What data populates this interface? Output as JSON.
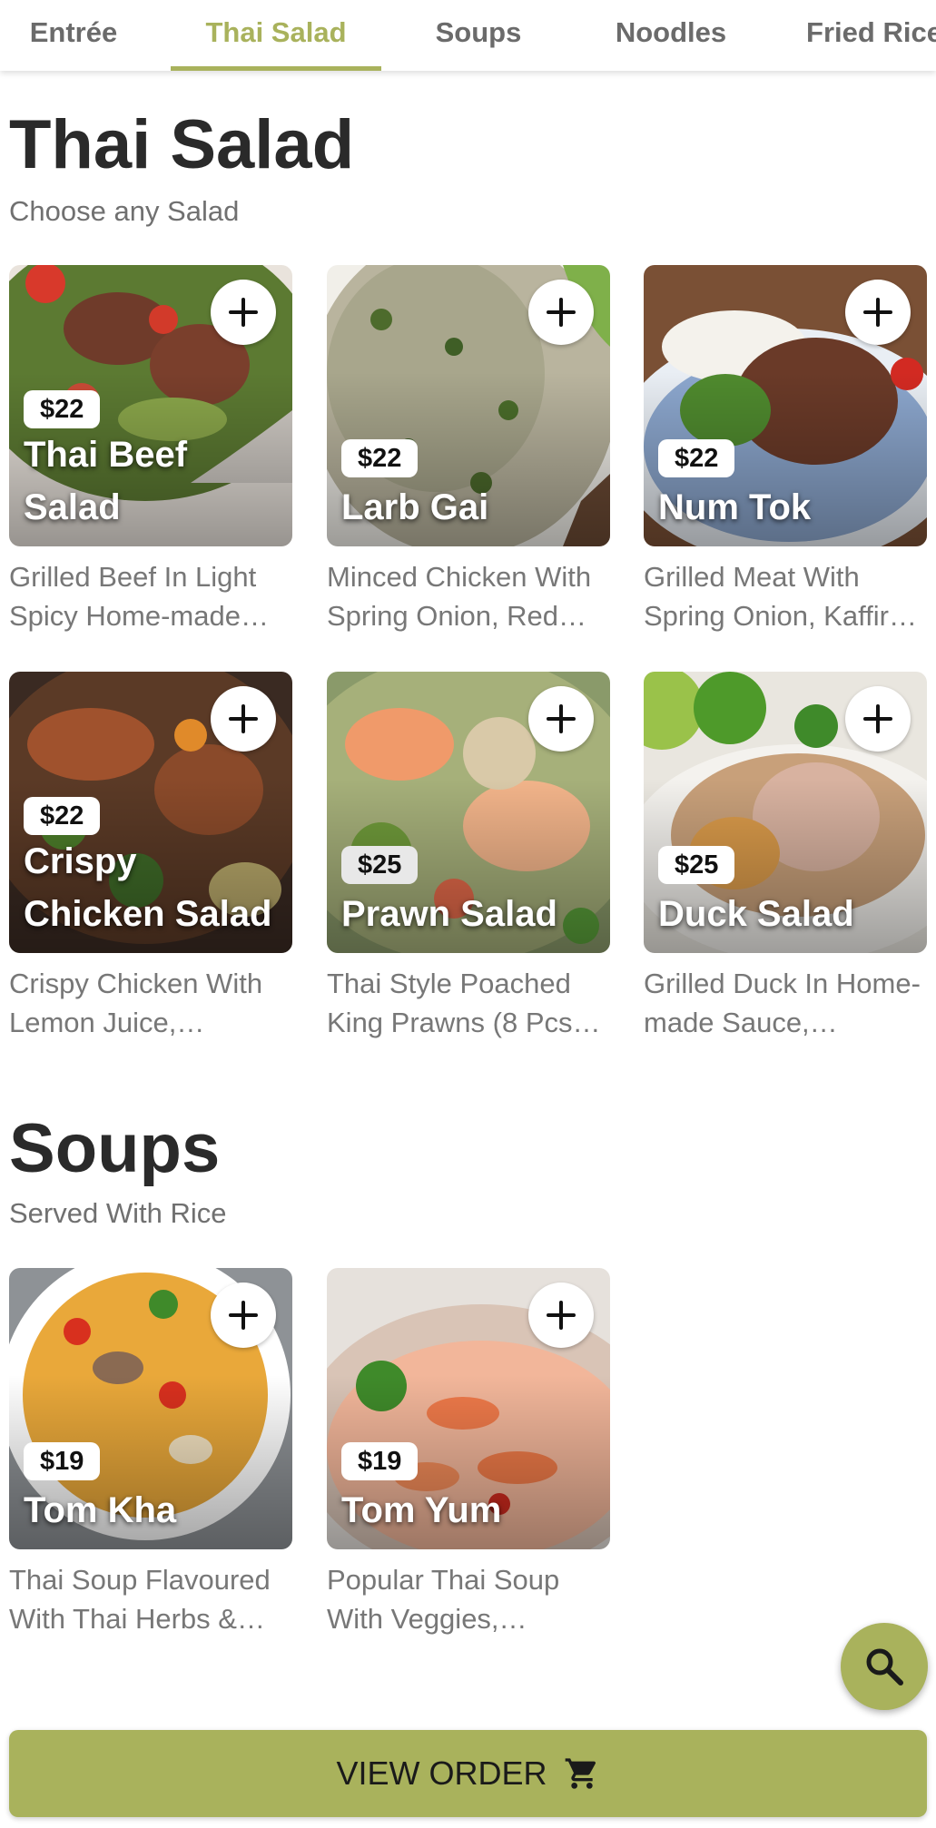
{
  "tabs": [
    {
      "label": "Entrée",
      "active": false
    },
    {
      "label": "Thai Salad",
      "active": true
    },
    {
      "label": "Soups",
      "active": false
    },
    {
      "label": "Noodles",
      "active": false
    },
    {
      "label": "Fried Rice",
      "active": false
    }
  ],
  "sections": [
    {
      "title": "Thai Salad",
      "subtitle": "Choose any Salad",
      "items": [
        {
          "name": "Thai Beef Salad",
          "price": "$22",
          "description": "Grilled Beef In Light Spicy Home-made…"
        },
        {
          "name": "Larb Gai",
          "price": "$22",
          "description": "Minced Chicken With Spring Onion, Red…"
        },
        {
          "name": "Num Tok",
          "price": "$22",
          "description": "Grilled Meat With Spring Onion, Kaffir…"
        },
        {
          "name": "Crispy Chicken Salad",
          "price": "$22",
          "description": "Crispy Chicken With Lemon Juice,…"
        },
        {
          "name": "Prawn Salad",
          "price": "$25",
          "description": "Thai Style Poached King Prawns (8 Pcs…"
        },
        {
          "name": "Duck Salad",
          "price": "$25",
          "description": "Grilled Duck In Home-made Sauce,…"
        }
      ]
    },
    {
      "title": "Soups",
      "subtitle": "Served With Rice",
      "items": [
        {
          "name": "Tom Kha",
          "price": "$19",
          "description": "Thai Soup Flavoured With Thai Herbs &…"
        },
        {
          "name": "Tom Yum",
          "price": "$19",
          "description": "Popular Thai Soup With Veggies,…"
        }
      ]
    }
  ],
  "fab": {
    "icon": "search-icon"
  },
  "footer": {
    "label": "VIEW ORDER",
    "icon": "cart-icon"
  },
  "colors": {
    "accent": "#a9b25c",
    "text_muted": "#777777",
    "title": "#2a2a2a"
  }
}
